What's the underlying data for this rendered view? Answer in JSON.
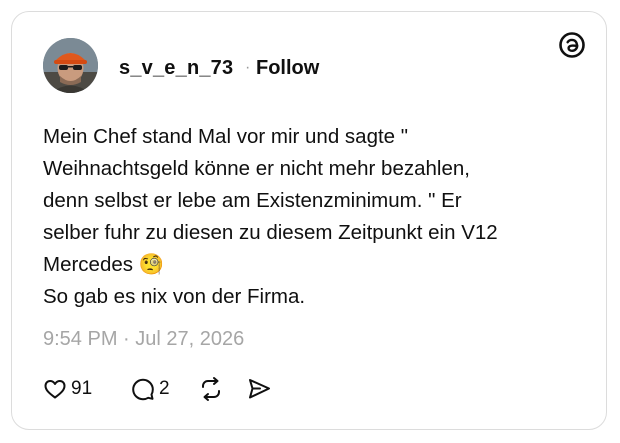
{
  "post": {
    "username": "s_v_e_n_73",
    "separator": "·",
    "follow_label": "Follow",
    "text": "Mein Chef stand Mal vor mir und sagte \"\nWeihnachtsgeld könne er nicht mehr bezahlen,\ndenn selbst er lebe am Existenzminimum. \" Er\nselber fuhr zu diesen zu diesem Zeitpunkt ein V12\nMercedes 🧐\nSo gab es nix von der Firma.",
    "timestamp": "9:54 PM · Jul 27, 2026"
  },
  "actions": {
    "likes": "91",
    "replies": "2"
  },
  "icons": {
    "brand": "threads-icon",
    "like": "heart-icon",
    "reply": "comment-bubble-icon",
    "repost": "repost-icon",
    "share": "share-send-icon"
  },
  "colors": {
    "text": "#101010",
    "muted": "#a6a6a6",
    "border": "#dcdcdc"
  }
}
